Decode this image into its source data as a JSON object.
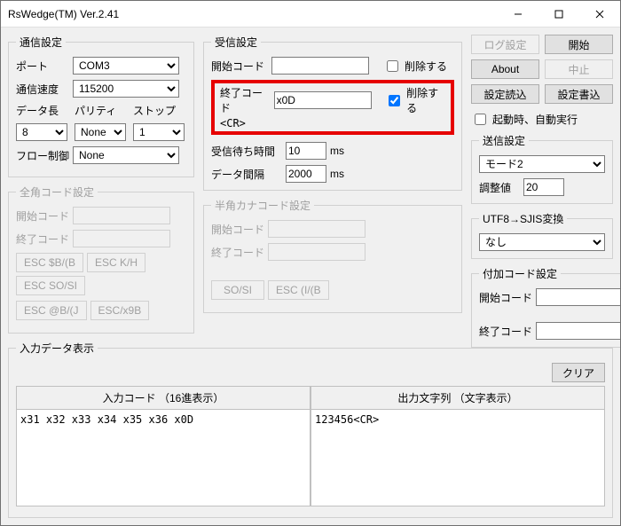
{
  "window": {
    "title": "RsWedge(TM) Ver.2.41"
  },
  "buttons": {
    "log_setting": "ログ設定",
    "start": "開始",
    "about": "About",
    "stop": "中止",
    "read_setting": "設定読込",
    "write_setting": "設定書込",
    "clear": "クリア"
  },
  "comm": {
    "legend": "通信設定",
    "port_label": "ポート",
    "port_value": "COM3",
    "baud_label": "通信速度",
    "baud_value": "115200",
    "data_label": "データ長",
    "parity_label": "パリティ",
    "stop_label": "ストップ",
    "data_value": "8",
    "parity_value": "None",
    "stop_value": "1",
    "flow_label": "フロー制御",
    "flow_value": "None"
  },
  "recv": {
    "legend": "受信設定",
    "start_code_label": "開始コード",
    "start_code_value": "",
    "start_delete_label": "削除する",
    "end_code_label": "終了コード",
    "end_code_value": "x0D",
    "end_code_friendly": "<CR>",
    "end_delete_label": "削除する",
    "wait_label": "受信待ち時間",
    "wait_value": "10",
    "wait_unit": "ms",
    "interval_label": "データ間隔",
    "interval_value": "2000",
    "interval_unit": "ms"
  },
  "auto": {
    "label": "起動時、自動実行"
  },
  "send": {
    "legend": "送信設定",
    "mode_value": "モード2",
    "adjust_label": "調整値",
    "adjust_value": "20"
  },
  "utf": {
    "legend": "UTF8→SJIS変換",
    "value": "なし"
  },
  "append": {
    "legend": "付加コード設定",
    "start_label": "開始コード",
    "start_value": "",
    "end_label": "終了コード",
    "end_value": ""
  },
  "zen": {
    "legend": "全角コード設定",
    "start_label": "開始コード",
    "end_label": "終了コード",
    "btn1": "ESC $B/(B",
    "btn2": "ESC K/H",
    "btn3": "ESC SO/SI",
    "btn4": "ESC @B/(J",
    "btn5": "ESC/x9B"
  },
  "han": {
    "legend": "半角カナコード設定",
    "start_label": "開始コード",
    "end_label": "終了コード",
    "btn1": "SO/SI",
    "btn2": "ESC (I/(B"
  },
  "io": {
    "legend": "入力データ表示",
    "in_header": "入力コード （16進表示）",
    "out_header": "出力文字列 （文字表示）",
    "in_body": "x31 x32 x33 x34 x35 x36 x0D",
    "out_body": "123456<CR>"
  }
}
